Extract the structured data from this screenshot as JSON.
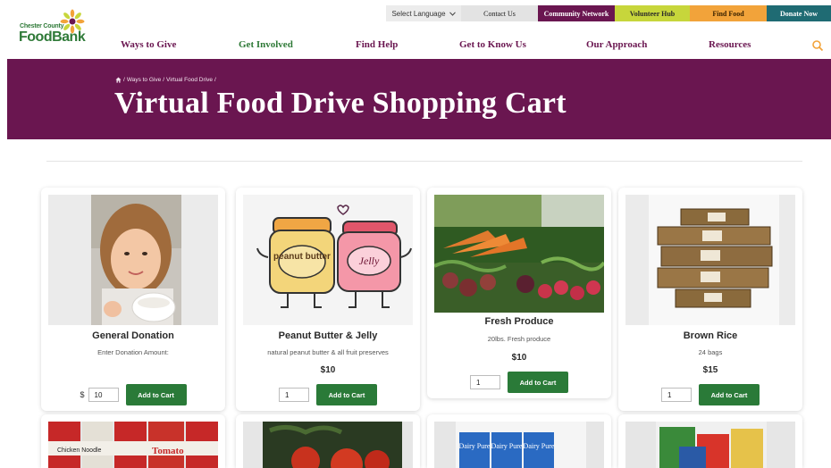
{
  "utility_bar": {
    "language": "Select Language",
    "contact": "Contact Us",
    "community": "Community Network",
    "volunteer": "Volunteer Hub",
    "find_food": "Find Food",
    "donate": "Donate Now"
  },
  "logo": {
    "line1": "Chester County",
    "line2": "FoodBank"
  },
  "nav": [
    "Ways to Give",
    "Get Involved",
    "Find Help",
    "Get to Know Us",
    "Our Approach",
    "Resources"
  ],
  "breadcrumb": {
    "items": [
      "Ways to Give",
      "Virtual Food Drive"
    ],
    "separator": "/"
  },
  "page_title": "Virtual Food Drive Shopping Cart",
  "products": [
    {
      "title": "General Donation",
      "desc": "Enter Donation Amount:",
      "price": "",
      "currency": "$",
      "qty": "10",
      "button": "Add to Cart"
    },
    {
      "title": "Peanut Butter & Jelly",
      "desc": "natural peanut butter & all fruit preserves",
      "price": "$10",
      "qty": "1",
      "button": "Add to Cart",
      "jar1": "peanut butter",
      "jar2": "Jelly"
    },
    {
      "title": "Fresh Produce",
      "desc": "20lbs. Fresh produce",
      "price": "$10",
      "qty": "1",
      "button": "Add to Cart"
    },
    {
      "title": "Brown Rice",
      "desc": "24 bags",
      "price": "$15",
      "qty": "1",
      "button": "Add to Cart"
    }
  ],
  "row2_labels": {
    "soup": "Tomato",
    "soup2": "Chicken Noodle",
    "dairy": "Dairy Pure"
  },
  "colors": {
    "brand_purple": "#6a1650",
    "brand_green": "#2f7a38",
    "button_green": "#2a7a38",
    "hero_bg": "#6a1650"
  },
  "icons": {
    "search": "search-icon",
    "home": "home-icon",
    "chevron": "chevron-down-icon"
  }
}
